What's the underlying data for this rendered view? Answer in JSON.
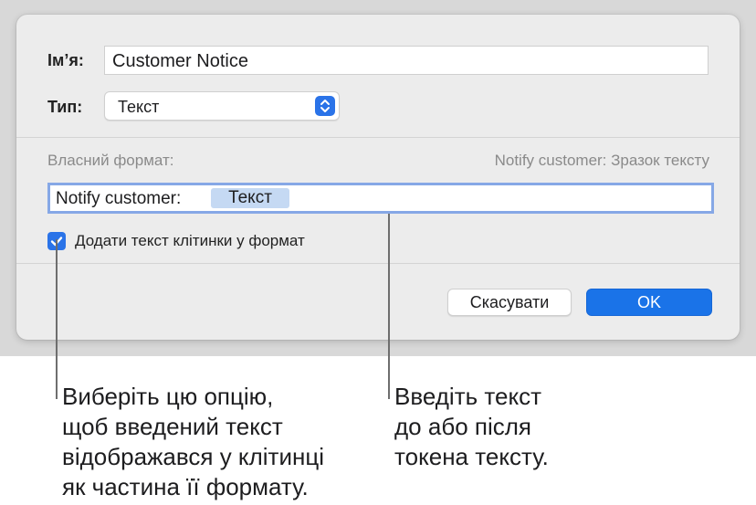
{
  "dialog": {
    "name_label": "Ім’я:",
    "name_value": "Customer Notice",
    "type_label": "Тип:",
    "type_value": "Текст",
    "custom_format_label": "Власний формат:",
    "format_sample": "Notify customer: Зразок тексту",
    "format_prefix": "Notify customer:",
    "format_token": "Текст",
    "checkbox_label": "Додати текст клітинки у формат",
    "checkbox_checked": true,
    "cancel_label": "Скасувати",
    "ok_label": "OK"
  },
  "callouts": {
    "left": [
      "Виберіть цю опцію,",
      "щоб введений текст",
      "відображався у клітинці",
      "як частина її формату."
    ],
    "right": [
      "Введіть текст",
      "до або після",
      "токена тексту."
    ]
  },
  "colors": {
    "accent": "#1a73e8",
    "token_bg": "#c5d9f3",
    "focus_ring": "#86a8e6"
  },
  "icons": {
    "select_arrows": "up-down-chevron-icon",
    "checkbox": "checkmark-icon"
  }
}
